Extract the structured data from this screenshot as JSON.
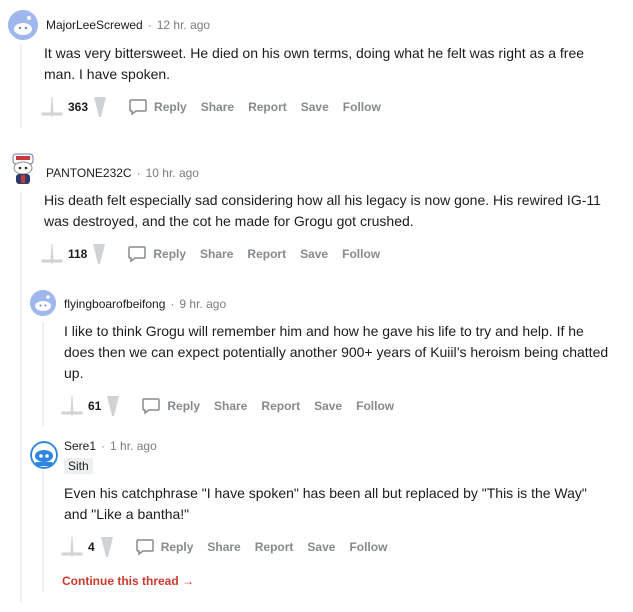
{
  "comments": [
    {
      "user": "MajorLeeScrewed",
      "time": "12 hr. ago",
      "text": "It was very bittersweet. He died on his own terms, doing what he felt was right as a free man. I have spoken.",
      "score": "363"
    },
    {
      "user": "PANTONE232C",
      "time": "10 hr. ago",
      "text": "His death felt especially sad considering how all his legacy is now gone. His rewired IG-11 was destroyed, and the cot he made for Grogu got crushed.",
      "score": "118"
    },
    {
      "user": "flyingboarofbeifong",
      "time": "9 hr. ago",
      "text": "I like to think Grogu will remember him and how he gave his life to try and help. If he does then we can expect potentially another 900+ years of Kuiil’s heroism being chatted up.",
      "score": "61"
    },
    {
      "user": "Sere1",
      "time": "1 hr. ago",
      "flair": "Sith",
      "text": "Even his catchphrase \"I have spoken\" has been all but replaced by \"This is the Way\" and \"Like a bantha!\"",
      "score": "4"
    }
  ],
  "actions": {
    "reply": "Reply",
    "share": "Share",
    "report": "Report",
    "save": "Save",
    "follow": "Follow"
  },
  "meta_separator": "·",
  "continue_thread": "Continue this thread →",
  "colors": {
    "accent_red": "#cc3a2d",
    "meta_gray": "#7c7c7c",
    "action_gray": "#878a8c",
    "thread_line": "#edeff1",
    "avatar_blue": "#8fa8e8"
  },
  "icons": {
    "upvote": "upvote-icon",
    "downvote": "downvote-icon",
    "reply": "comment-bubble-icon"
  }
}
